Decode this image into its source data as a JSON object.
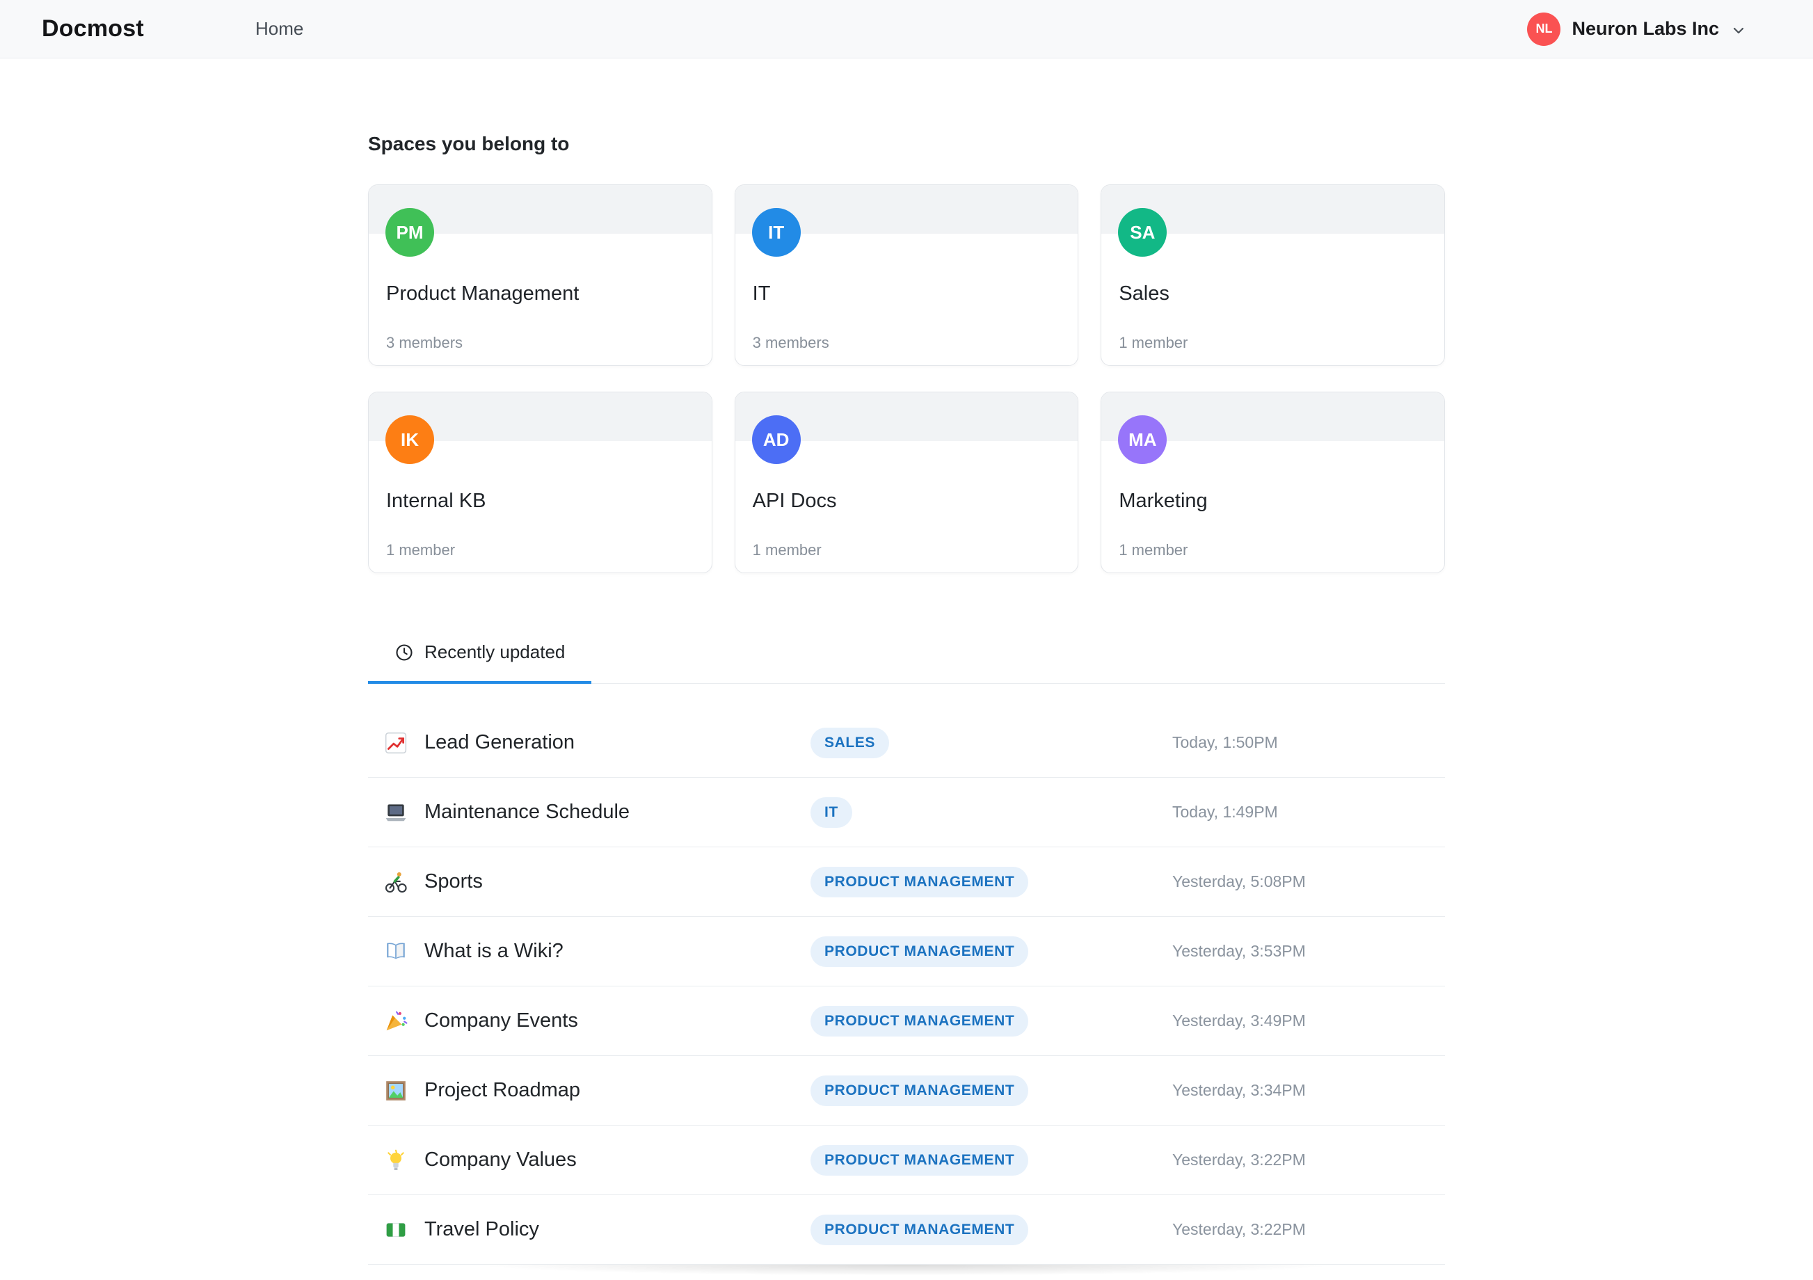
{
  "header": {
    "logo": "Docmost",
    "nav_home": "Home",
    "workspace": {
      "initials": "NL",
      "name": "Neuron Labs Inc",
      "color": "#fa5252"
    }
  },
  "spaces": {
    "heading": "Spaces you belong to",
    "cards": [
      {
        "initials": "PM",
        "color": "#40c057",
        "name": "Product Management",
        "members": "3 members"
      },
      {
        "initials": "IT",
        "color": "#228be6",
        "name": "IT",
        "members": "3 members"
      },
      {
        "initials": "SA",
        "color": "#12b886",
        "name": "Sales",
        "members": "1 member"
      },
      {
        "initials": "IK",
        "color": "#fd7e14",
        "name": "Internal KB",
        "members": "1 member"
      },
      {
        "initials": "AD",
        "color": "#4c6ef5",
        "name": "API Docs",
        "members": "1 member"
      },
      {
        "initials": "MA",
        "color": "#9775fa",
        "name": "Marketing",
        "members": "1 member"
      }
    ]
  },
  "recent": {
    "tab_label": "Recently updated",
    "badge_colors": {
      "bg": "#e7f1fb",
      "text": "#1b72c0"
    },
    "rows": [
      {
        "icon": "chart",
        "title": "Lead Generation",
        "badge": "SALES",
        "time": "Today, 1:50PM"
      },
      {
        "icon": "laptop",
        "title": "Maintenance Schedule",
        "badge": "IT",
        "time": "Today, 1:49PM"
      },
      {
        "icon": "cyclist",
        "title": "Sports",
        "badge": "PRODUCT MANAGEMENT",
        "time": "Yesterday, 5:08PM"
      },
      {
        "icon": "book",
        "title": "What is a Wiki?",
        "badge": "PRODUCT MANAGEMENT",
        "time": "Yesterday, 3:53PM"
      },
      {
        "icon": "party",
        "title": "Company Events",
        "badge": "PRODUCT MANAGEMENT",
        "time": "Yesterday, 3:49PM"
      },
      {
        "icon": "picture",
        "title": "Project Roadmap",
        "badge": "PRODUCT MANAGEMENT",
        "time": "Yesterday, 3:34PM"
      },
      {
        "icon": "bulb",
        "title": "Company Values",
        "badge": "PRODUCT MANAGEMENT",
        "time": "Yesterday, 3:22PM"
      },
      {
        "icon": "flag",
        "title": "Travel Policy",
        "badge": "PRODUCT MANAGEMENT",
        "time": "Yesterday, 3:22PM"
      }
    ]
  }
}
